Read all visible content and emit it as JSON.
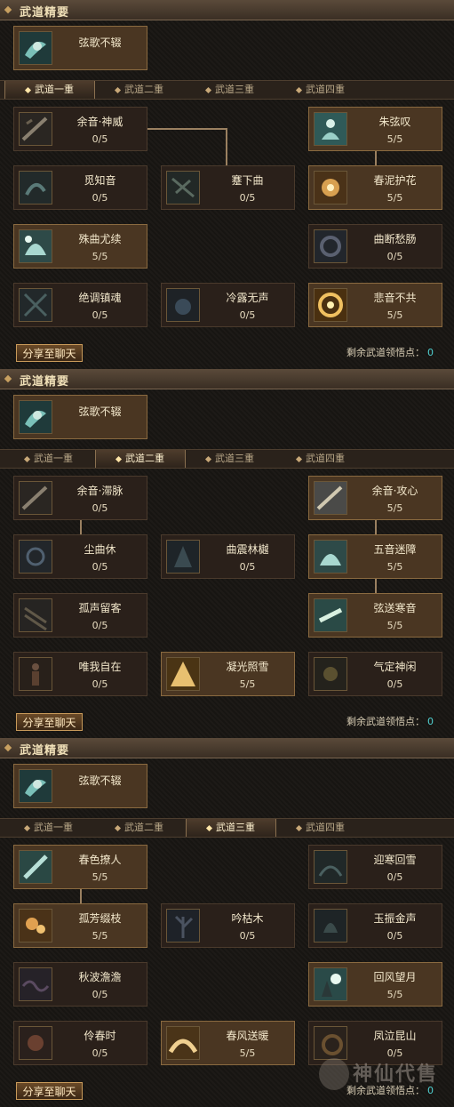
{
  "sections": [
    {
      "title": "武道精要",
      "essence": {
        "name": "弦歌不辍",
        "icon": "swirl-tome-icon"
      },
      "tabs": [
        "武道一重",
        "武道二重",
        "武道三重",
        "武道四重"
      ],
      "active_tab": 0,
      "nodes": [
        {
          "name": "余音·神威",
          "points": "0/5",
          "icon": "flute-strike-icon"
        },
        {
          "name": "朱弦叹",
          "points": "5/5",
          "icon": "meditating-figure-icon"
        },
        {
          "name": "觅知音",
          "points": "0/5",
          "icon": "listening-ear-icon"
        },
        {
          "name": "蹇下曲",
          "points": "0/5",
          "icon": "falling-notes-icon"
        },
        {
          "name": "春泥护花",
          "points": "5/5",
          "icon": "blooming-flower-icon"
        },
        {
          "name": "殊曲尤续",
          "points": "5/5",
          "icon": "crescent-scroll-icon"
        },
        {
          "name": "曲断愁肠",
          "points": "0/5",
          "icon": "broken-string-icon"
        },
        {
          "name": "绝调镇魂",
          "points": "0/5",
          "icon": "soul-seal-icon"
        },
        {
          "name": "冷露无声",
          "points": "0/5",
          "icon": "silent-dew-icon"
        },
        {
          "name": "悲音不共",
          "points": "5/5",
          "icon": "golden-vortex-icon"
        }
      ],
      "share_label": "分享至聊天",
      "remaining_label": "剩余武道领悟点：",
      "remaining_value": "0"
    },
    {
      "title": "武道精要",
      "essence": {
        "name": "弦歌不辍",
        "icon": "swirl-tome-icon"
      },
      "tabs": [
        "武道一重",
        "武道二重",
        "武道三重",
        "武道四重"
      ],
      "active_tab": 1,
      "nodes": [
        {
          "name": "余音·滞脉",
          "points": "0/5",
          "icon": "flute-strike-icon"
        },
        {
          "name": "余音·攻心",
          "points": "5/5",
          "icon": "flute-strike-icon"
        },
        {
          "name": "尘曲休",
          "points": "0/5",
          "icon": "dust-spiral-icon"
        },
        {
          "name": "曲震林樾",
          "points": "0/5",
          "icon": "forest-quake-icon"
        },
        {
          "name": "五音迷障",
          "points": "5/5",
          "icon": "crescent-scroll-icon"
        },
        {
          "name": "孤声留客",
          "points": "0/5",
          "icon": "lone-echo-icon"
        },
        {
          "name": "弦送寒音",
          "points": "5/5",
          "icon": "frost-string-icon"
        },
        {
          "name": "唯我自在",
          "points": "0/5",
          "icon": "standing-warrior-icon"
        },
        {
          "name": "凝光照雪",
          "points": "5/5",
          "icon": "golden-light-icon"
        },
        {
          "name": "气定神闲",
          "points": "0/5",
          "icon": "calm-spirit-icon"
        }
      ],
      "share_label": "分享至聊天",
      "remaining_label": "剩余武道领悟点：",
      "remaining_value": "0"
    },
    {
      "title": "武道精要",
      "essence": {
        "name": "弦歌不辍",
        "icon": "swirl-tome-icon"
      },
      "tabs": [
        "武道一重",
        "武道二重",
        "武道三重",
        "武道四重"
      ],
      "active_tab": 2,
      "nodes": [
        {
          "name": "春色撩人",
          "points": "5/5",
          "icon": "spring-scroll-icon"
        },
        {
          "name": "迎寒回雪",
          "points": "0/5",
          "icon": "snow-return-icon"
        },
        {
          "name": "孤芳缀枝",
          "points": "5/5",
          "icon": "flower-branch-icon"
        },
        {
          "name": "吟枯木",
          "points": "0/5",
          "icon": "withered-tree-icon"
        },
        {
          "name": "玉振金声",
          "points": "0/5",
          "icon": "jade-bell-icon"
        },
        {
          "name": "秋波澹澹",
          "points": "0/5",
          "icon": "autumn-wave-icon"
        },
        {
          "name": "回风望月",
          "points": "5/5",
          "icon": "moon-gaze-icon"
        },
        {
          "name": "伶春时",
          "points": "0/5",
          "icon": "spring-flower-icon"
        },
        {
          "name": "春风送暖",
          "points": "5/5",
          "icon": "warm-breeze-icon"
        },
        {
          "name": "凤泣昆山",
          "points": "0/5",
          "icon": "phoenix-cry-icon"
        }
      ],
      "share_label": "分享至聊天",
      "remaining_label": "剩余武道领悟点：",
      "remaining_value": "0"
    }
  ],
  "watermark": "神仙代售",
  "colors": {
    "full_node": "#4a3622",
    "empty_node": "#2a201a",
    "accent": "#c89a5a",
    "remaining_value": "#4fd0d0"
  }
}
